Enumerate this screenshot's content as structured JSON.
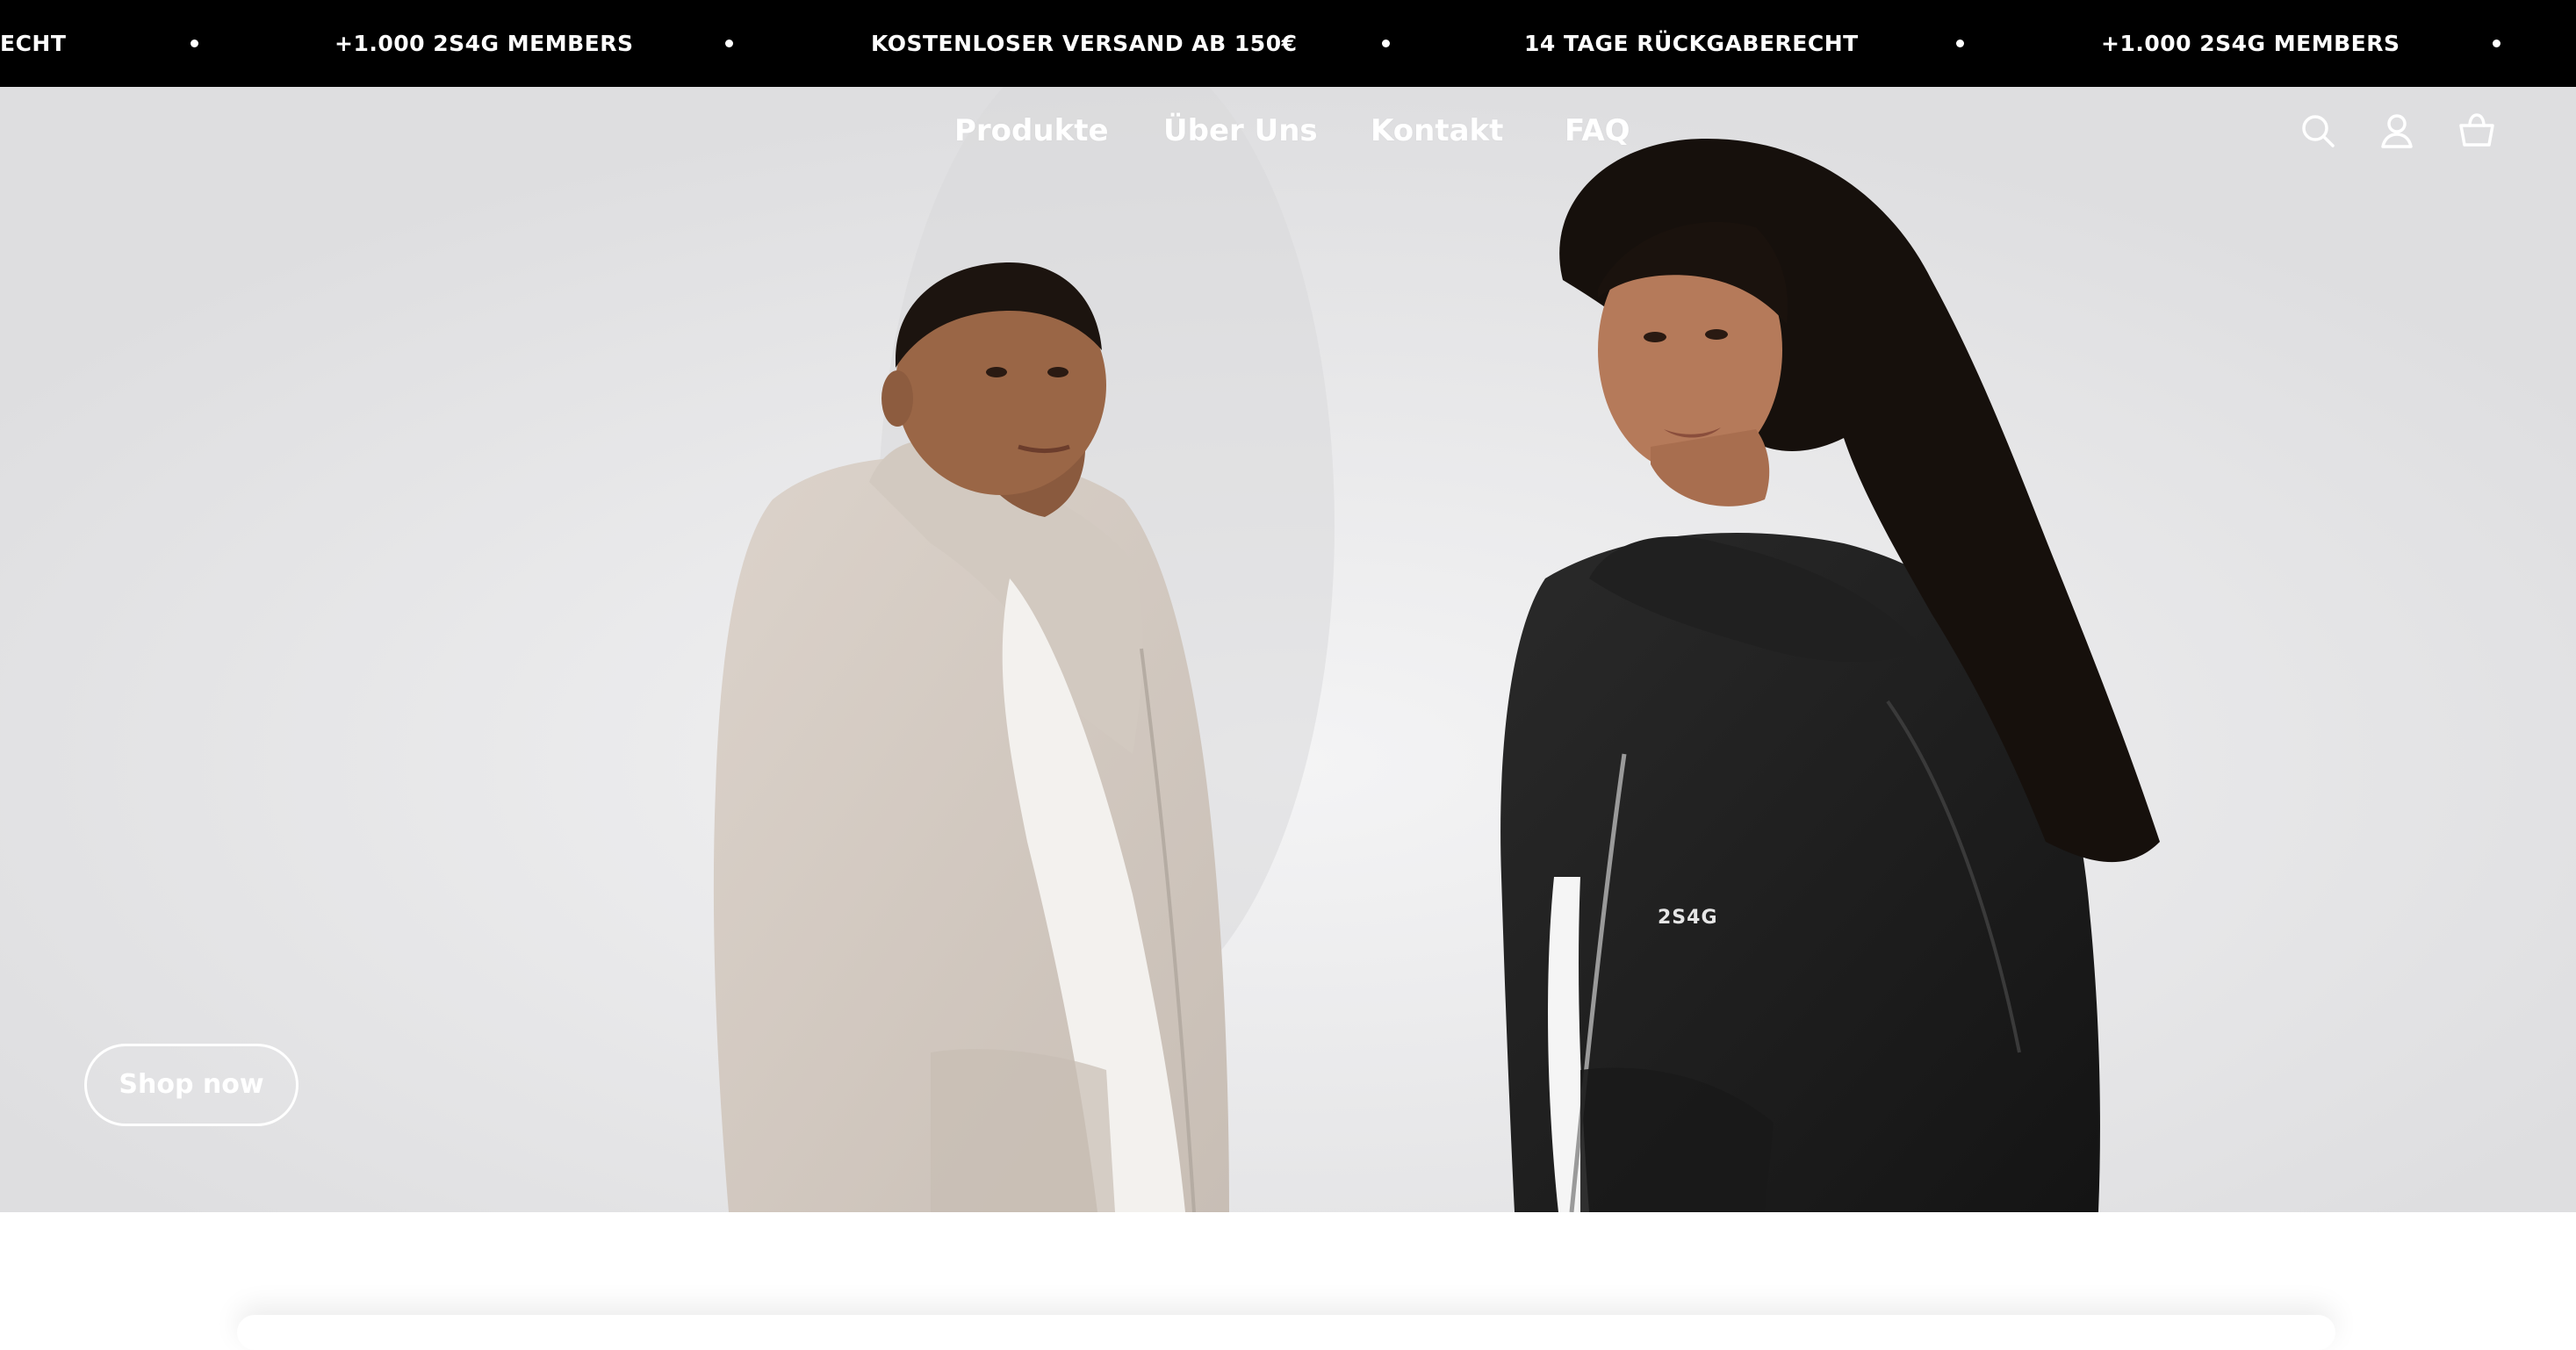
{
  "announcement": {
    "items": [
      "ECHT",
      "+1.000 2S4G MEMBERS",
      "KOSTENLOSER VERSAND AB 150€",
      "14 TAGE RÜCKGABERECHT",
      "+1.000 2S4G MEMBERS"
    ]
  },
  "nav": {
    "links": [
      "Produkte",
      "Über Uns",
      "Kontakt",
      "FAQ"
    ],
    "icons": [
      "search-icon",
      "account-icon",
      "cart-icon"
    ]
  },
  "hero": {
    "jacket_print": "2S4G",
    "cta_label": "Shop now"
  },
  "colors": {
    "announcement_bg": "#000000",
    "announcement_text": "#ffffff",
    "nav_text": "#ffffff",
    "hero_background": "#e8e8ea"
  }
}
